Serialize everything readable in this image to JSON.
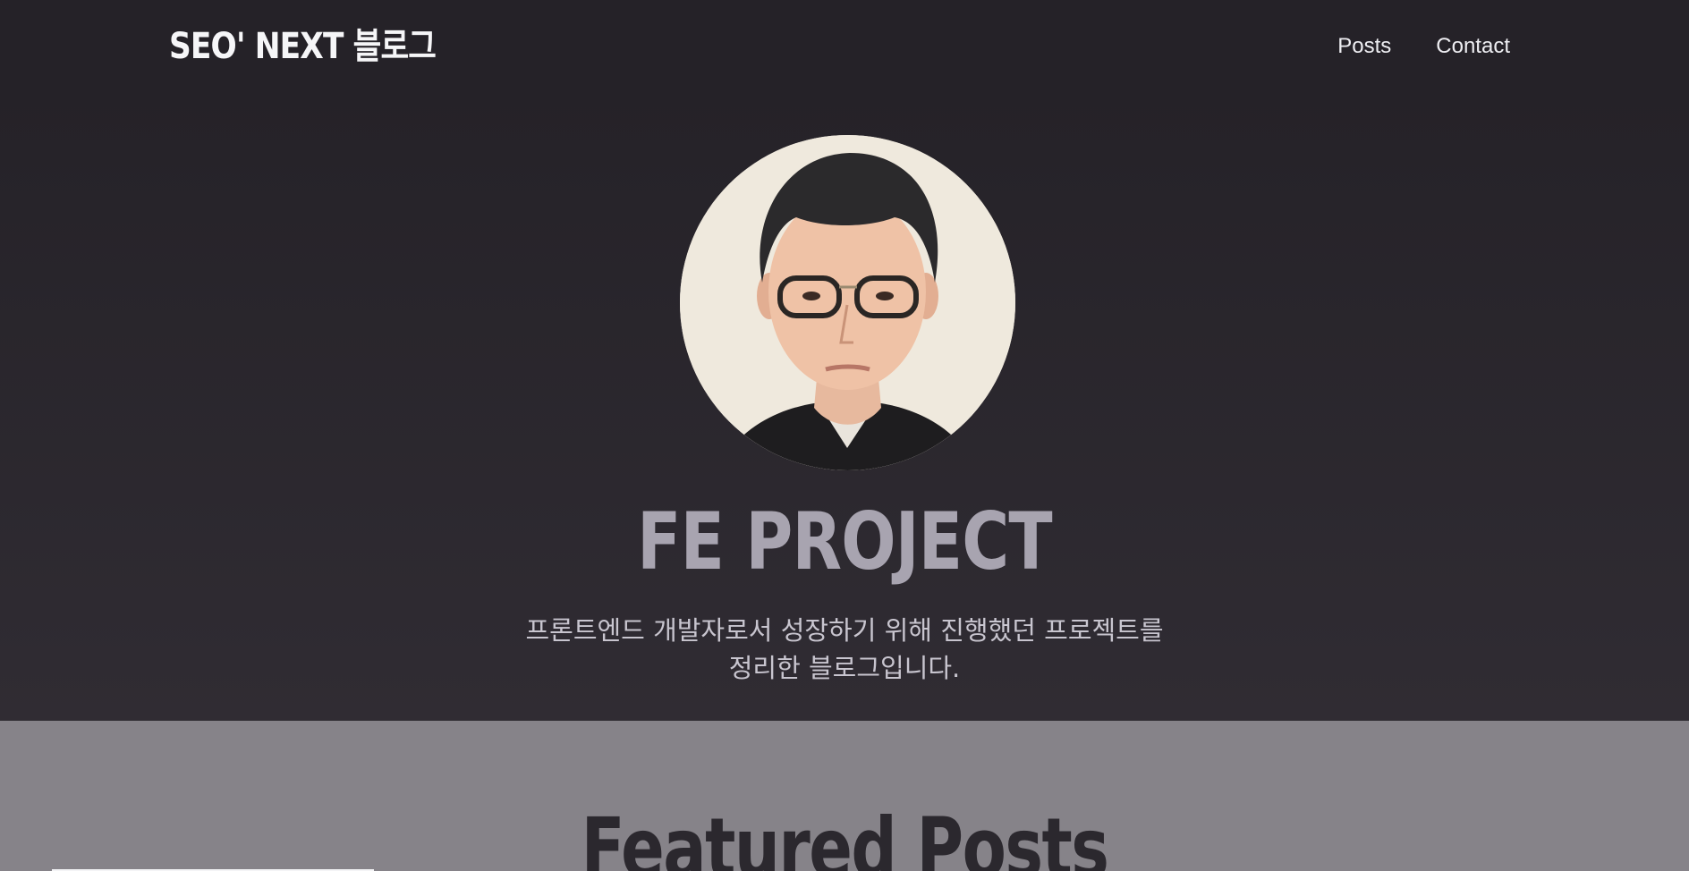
{
  "header": {
    "logo": "SEO' NEXT 블로그",
    "nav": [
      "Posts",
      "Contact"
    ]
  },
  "hero": {
    "avatar_alt": "profile-photo",
    "title": "FE PROJECT",
    "description_line1": "프론트엔드 개발자로서 성장하기 위해 진행했던 프로젝트를",
    "description_line2": "정리한 블로그입니다."
  },
  "featured": {
    "title": "Featured Posts"
  },
  "colors": {
    "header_bg": "#252228",
    "hero_title": "#a8a4b0",
    "featured_bg": "#868389",
    "featured_title": "#2b282e"
  }
}
